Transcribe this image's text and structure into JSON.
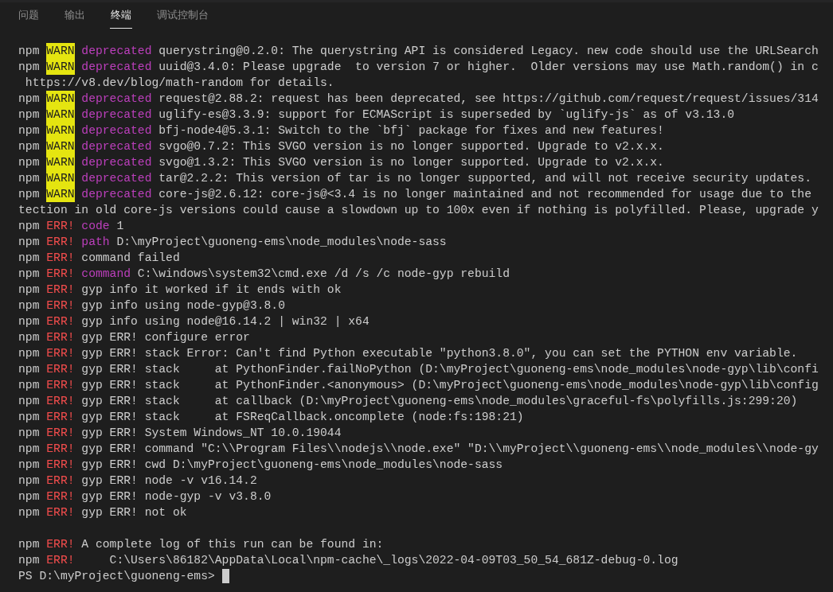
{
  "tabs": [
    {
      "label": "问题",
      "selected": false
    },
    {
      "label": "输出",
      "selected": false
    },
    {
      "label": "终端",
      "selected": true
    },
    {
      "label": "调试控制台",
      "selected": false
    }
  ],
  "lines": [
    [
      {
        "kind": "plain",
        "text": "npm"
      },
      {
        "kind": "warn",
        "text": "WARN"
      },
      {
        "kind": "key",
        "text": "deprecated"
      },
      {
        "kind": "plain",
        "text": "querystring@0.2.0: The querystring API is considered Legacy. new code should use the URLSearch"
      }
    ],
    [
      {
        "kind": "plain",
        "text": "npm"
      },
      {
        "kind": "warn",
        "text": "WARN"
      },
      {
        "kind": "key",
        "text": "deprecated"
      },
      {
        "kind": "plain",
        "text": "uuid@3.4.0: Please upgrade  to version 7 or higher.  Older versions may use Math.random() in c"
      }
    ],
    [
      {
        "kind": "plain",
        "text": " https://v8.dev/blog/math-random for details."
      }
    ],
    [
      {
        "kind": "plain",
        "text": "npm"
      },
      {
        "kind": "warn",
        "text": "WARN"
      },
      {
        "kind": "key",
        "text": "deprecated"
      },
      {
        "kind": "plain",
        "text": "request@2.88.2: request has been deprecated, see https://github.com/request/request/issues/314"
      }
    ],
    [
      {
        "kind": "plain",
        "text": "npm"
      },
      {
        "kind": "warn",
        "text": "WARN"
      },
      {
        "kind": "key",
        "text": "deprecated"
      },
      {
        "kind": "plain",
        "text": "uglify-es@3.3.9: support for ECMAScript is superseded by `uglify-js` as of v3.13.0"
      }
    ],
    [
      {
        "kind": "plain",
        "text": "npm"
      },
      {
        "kind": "warn",
        "text": "WARN"
      },
      {
        "kind": "key",
        "text": "deprecated"
      },
      {
        "kind": "plain",
        "text": "bfj-node4@5.3.1: Switch to the `bfj` package for fixes and new features!"
      }
    ],
    [
      {
        "kind": "plain",
        "text": "npm"
      },
      {
        "kind": "warn",
        "text": "WARN"
      },
      {
        "kind": "key",
        "text": "deprecated"
      },
      {
        "kind": "plain",
        "text": "svgo@0.7.2: This SVGO version is no longer supported. Upgrade to v2.x.x."
      }
    ],
    [
      {
        "kind": "plain",
        "text": "npm"
      },
      {
        "kind": "warn",
        "text": "WARN"
      },
      {
        "kind": "key",
        "text": "deprecated"
      },
      {
        "kind": "plain",
        "text": "svgo@1.3.2: This SVGO version is no longer supported. Upgrade to v2.x.x."
      }
    ],
    [
      {
        "kind": "plain",
        "text": "npm"
      },
      {
        "kind": "warn",
        "text": "WARN"
      },
      {
        "kind": "key",
        "text": "deprecated"
      },
      {
        "kind": "plain",
        "text": "tar@2.2.2: This version of tar is no longer supported, and will not receive security updates."
      }
    ],
    [
      {
        "kind": "plain",
        "text": "npm"
      },
      {
        "kind": "warn",
        "text": "WARN"
      },
      {
        "kind": "key",
        "text": "deprecated"
      },
      {
        "kind": "plain",
        "text": "core-js@2.6.12: core-js@<3.4 is no longer maintained and not recommended for usage due to the"
      }
    ],
    [
      {
        "kind": "plain",
        "text": "tection in old core-js versions could cause a slowdown up to 100x even if nothing is polyfilled. Please, upgrade y"
      }
    ],
    [
      {
        "kind": "plain",
        "text": "npm"
      },
      {
        "kind": "err",
        "text": "ERR!"
      },
      {
        "kind": "key",
        "text": "code"
      },
      {
        "kind": "plain",
        "text": "1"
      }
    ],
    [
      {
        "kind": "plain",
        "text": "npm"
      },
      {
        "kind": "err",
        "text": "ERR!"
      },
      {
        "kind": "key",
        "text": "path"
      },
      {
        "kind": "plain",
        "text": "D:\\myProject\\guoneng-ems\\node_modules\\node-sass"
      }
    ],
    [
      {
        "kind": "plain",
        "text": "npm"
      },
      {
        "kind": "err",
        "text": "ERR!"
      },
      {
        "kind": "plain",
        "text": "command failed"
      }
    ],
    [
      {
        "kind": "plain",
        "text": "npm"
      },
      {
        "kind": "err",
        "text": "ERR!"
      },
      {
        "kind": "key",
        "text": "command"
      },
      {
        "kind": "plain",
        "text": "C:\\windows\\system32\\cmd.exe /d /s /c node-gyp rebuild"
      }
    ],
    [
      {
        "kind": "plain",
        "text": "npm"
      },
      {
        "kind": "err",
        "text": "ERR!"
      },
      {
        "kind": "plain",
        "text": "gyp info it worked if it ends with ok"
      }
    ],
    [
      {
        "kind": "plain",
        "text": "npm"
      },
      {
        "kind": "err",
        "text": "ERR!"
      },
      {
        "kind": "plain",
        "text": "gyp info using node-gyp@3.8.0"
      }
    ],
    [
      {
        "kind": "plain",
        "text": "npm"
      },
      {
        "kind": "err",
        "text": "ERR!"
      },
      {
        "kind": "plain",
        "text": "gyp info using node@16.14.2 | win32 | x64"
      }
    ],
    [
      {
        "kind": "plain",
        "text": "npm"
      },
      {
        "kind": "err",
        "text": "ERR!"
      },
      {
        "kind": "plain",
        "text": "gyp ERR! configure error"
      }
    ],
    [
      {
        "kind": "plain",
        "text": "npm"
      },
      {
        "kind": "err",
        "text": "ERR!"
      },
      {
        "kind": "plain",
        "text": "gyp ERR! stack Error: Can't find Python executable \"python3.8.0\", you can set the PYTHON env variable."
      }
    ],
    [
      {
        "kind": "plain",
        "text": "npm"
      },
      {
        "kind": "err",
        "text": "ERR!"
      },
      {
        "kind": "plain",
        "text": "gyp ERR! stack     at PythonFinder.failNoPython (D:\\myProject\\guoneng-ems\\node_modules\\node-gyp\\lib\\confi"
      }
    ],
    [
      {
        "kind": "plain",
        "text": "npm"
      },
      {
        "kind": "err",
        "text": "ERR!"
      },
      {
        "kind": "plain",
        "text": "gyp ERR! stack     at PythonFinder.<anonymous> (D:\\myProject\\guoneng-ems\\node_modules\\node-gyp\\lib\\config"
      }
    ],
    [
      {
        "kind": "plain",
        "text": "npm"
      },
      {
        "kind": "err",
        "text": "ERR!"
      },
      {
        "kind": "plain",
        "text": "gyp ERR! stack     at callback (D:\\myProject\\guoneng-ems\\node_modules\\graceful-fs\\polyfills.js:299:20)"
      }
    ],
    [
      {
        "kind": "plain",
        "text": "npm"
      },
      {
        "kind": "err",
        "text": "ERR!"
      },
      {
        "kind": "plain",
        "text": "gyp ERR! stack     at FSReqCallback.oncomplete (node:fs:198:21)"
      }
    ],
    [
      {
        "kind": "plain",
        "text": "npm"
      },
      {
        "kind": "err",
        "text": "ERR!"
      },
      {
        "kind": "plain",
        "text": "gyp ERR! System Windows_NT 10.0.19044"
      }
    ],
    [
      {
        "kind": "plain",
        "text": "npm"
      },
      {
        "kind": "err",
        "text": "ERR!"
      },
      {
        "kind": "plain",
        "text": "gyp ERR! command \"C:\\\\Program Files\\\\nodejs\\\\node.exe\" \"D:\\\\myProject\\\\guoneng-ems\\\\node_modules\\\\node-gy"
      }
    ],
    [
      {
        "kind": "plain",
        "text": "npm"
      },
      {
        "kind": "err",
        "text": "ERR!"
      },
      {
        "kind": "plain",
        "text": "gyp ERR! cwd D:\\myProject\\guoneng-ems\\node_modules\\node-sass"
      }
    ],
    [
      {
        "kind": "plain",
        "text": "npm"
      },
      {
        "kind": "err",
        "text": "ERR!"
      },
      {
        "kind": "plain",
        "text": "gyp ERR! node -v v16.14.2"
      }
    ],
    [
      {
        "kind": "plain",
        "text": "npm"
      },
      {
        "kind": "err",
        "text": "ERR!"
      },
      {
        "kind": "plain",
        "text": "gyp ERR! node-gyp -v v3.8.0"
      }
    ],
    [
      {
        "kind": "plain",
        "text": "npm"
      },
      {
        "kind": "err",
        "text": "ERR!"
      },
      {
        "kind": "plain",
        "text": "gyp ERR! not ok"
      }
    ],
    [
      {
        "kind": "gap"
      }
    ],
    [
      {
        "kind": "plain",
        "text": "npm"
      },
      {
        "kind": "err",
        "text": "ERR!"
      },
      {
        "kind": "plain",
        "text": "A complete log of this run can be found in:"
      }
    ],
    [
      {
        "kind": "plain",
        "text": "npm"
      },
      {
        "kind": "err",
        "text": "ERR!"
      },
      {
        "kind": "plain",
        "text": "    C:\\Users\\86182\\AppData\\Local\\npm-cache\\_logs\\2022-04-09T03_50_54_681Z-debug-0.log"
      }
    ],
    [
      {
        "kind": "prompt",
        "text": "PS D:\\myProject\\guoneng-ems>"
      }
    ]
  ]
}
